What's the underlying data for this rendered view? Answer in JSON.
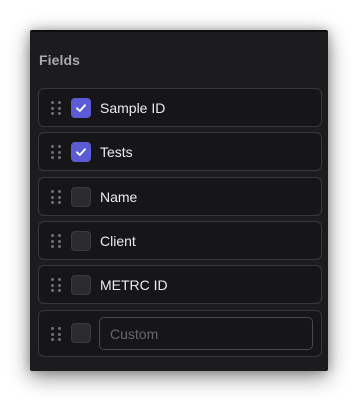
{
  "panel": {
    "title": "Fields"
  },
  "fields": [
    {
      "label": "Sample ID",
      "checked": true
    },
    {
      "label": "Tests",
      "checked": true
    },
    {
      "label": "Name",
      "checked": false
    },
    {
      "label": "Client",
      "checked": false
    },
    {
      "label": "METRC ID",
      "checked": false
    }
  ],
  "custom_field": {
    "checked": false,
    "value": "",
    "placeholder": "Custom"
  },
  "icons": {
    "drag": "drag-handle-icon",
    "check": "check-icon"
  },
  "colors": {
    "panel_background": "#1c1c1f",
    "row_background": "#161618",
    "row_border": "#37373c",
    "checkbox_checked": "#5b5bd6",
    "checkbox_unchecked": "#2c2c30",
    "title_text": "#a9aab0",
    "label_text": "#ececef"
  }
}
